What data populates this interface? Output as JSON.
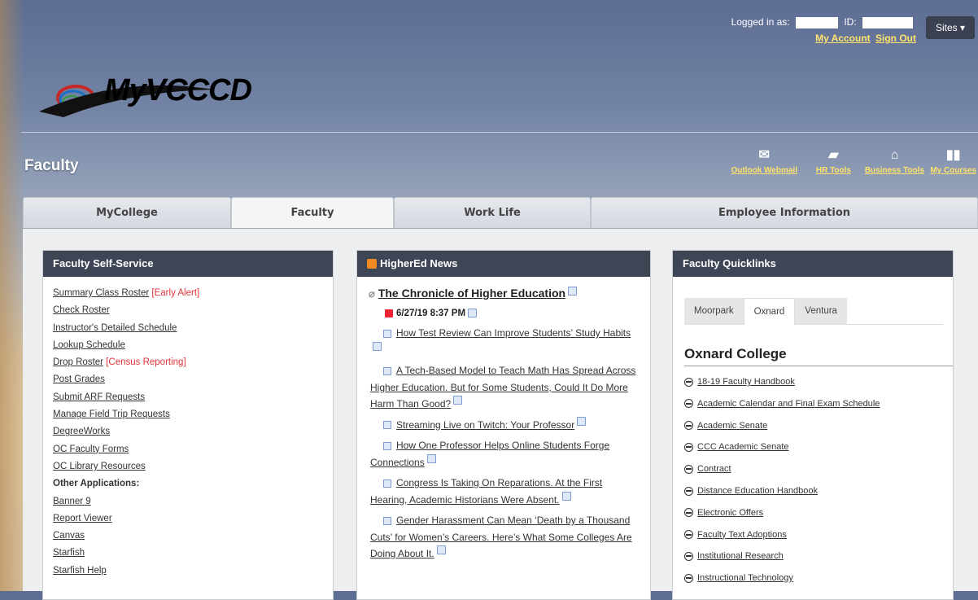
{
  "header": {
    "logged_in_label": "Logged in as:",
    "id_label": "ID:",
    "my_account": "My Account",
    "sign_out": "Sign Out",
    "sites_label": "Sites ▾",
    "logo_text": "MyVCCCD",
    "page_title": "Faculty"
  },
  "quicklinks_bar": [
    {
      "label": "Outlook Webmail",
      "icon": "envelope-icon"
    },
    {
      "label": "HR Tools",
      "icon": "briefcase-icon"
    },
    {
      "label": "Business Tools",
      "icon": "bank-icon"
    },
    {
      "label": "My Courses",
      "icon": "books-icon"
    }
  ],
  "tabs": [
    "MyCollege",
    "Faculty",
    "Work Life",
    "Employee Information"
  ],
  "active_tab": "Faculty",
  "faculty_self_service": {
    "title": "Faculty Self-Service",
    "items": [
      {
        "label": "Summary Class Roster",
        "alert": "[Early Alert]"
      },
      {
        "label": "Check Roster"
      },
      {
        "label": "Instructor's Detailed Schedule"
      },
      {
        "label": "Lookup Schedule"
      },
      {
        "label": "Drop Roster",
        "alert": "[Census Reporting]"
      },
      {
        "label": "Post Grades"
      },
      {
        "label": "Submit ARF Requests"
      },
      {
        "label": "Manage Field Trip Requests"
      },
      {
        "label": "DegreeWorks"
      },
      {
        "label": "OC Faculty Forms"
      },
      {
        "label": "OC Library Resources"
      },
      {
        "label": "Other Applications:",
        "header": true
      },
      {
        "label": "Banner 9"
      },
      {
        "label": "Report Viewer"
      },
      {
        "label": "Canvas"
      },
      {
        "label": "Starfish"
      },
      {
        "label": "Starfish Help"
      }
    ]
  },
  "news": {
    "title": "HigherEd News",
    "source": "The Chronicle of Higher Education",
    "date": "6/27/19 8:37 PM",
    "articles": [
      "How Test Review Can Improve Students’ Study Habits",
      "A Tech-Based Model to Teach Math Has Spread Across Higher Education. But for Some Students, Could It Do More Harm Than Good?",
      "Streaming Live on Twitch: Your Professor",
      "How One Professor Helps Online Students Forge Connections",
      "Congress Is Taking On Reparations. At the First Hearing, Academic Historians Were Absent.",
      "Gender Harassment Can Mean ‘Death by a Thousand Cuts’ for Women’s Careers. Here’s What Some Colleges Are Doing About It."
    ]
  },
  "faculty_quicklinks": {
    "title": "Faculty Quicklinks",
    "subtabs": [
      "Moorpark",
      "Oxnard",
      "Ventura"
    ],
    "active_subtab": "Oxnard",
    "college_title": "Oxnard College",
    "links": [
      "18-19 Faculty Handbook",
      "Academic Calendar and Final Exam Schedule",
      "Academic Senate",
      "CCC Academic Senate",
      "Contract",
      "Distance Education Handbook",
      "Electronic Offers",
      "Faculty Text Adoptions",
      "Institutional Research",
      "Instructional Technology"
    ]
  }
}
